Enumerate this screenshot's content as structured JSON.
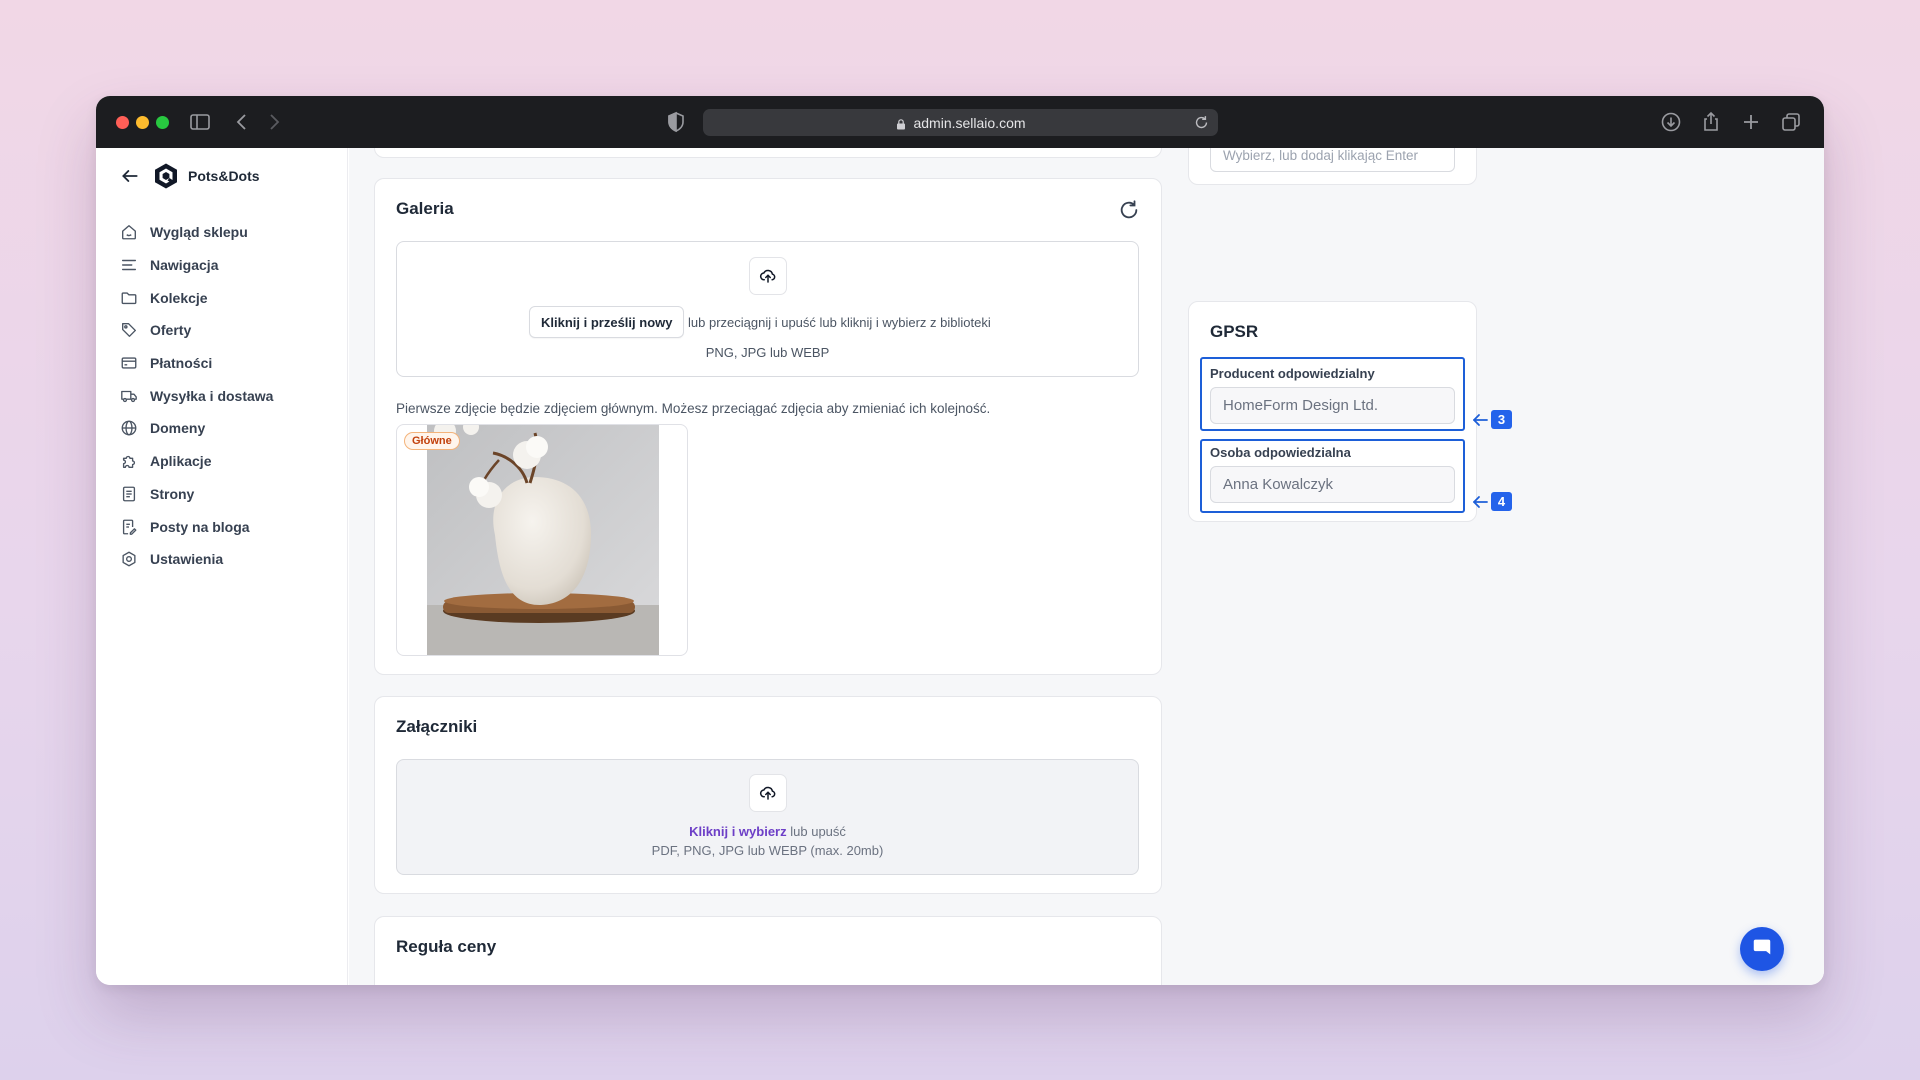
{
  "browser": {
    "url": "admin.sellaio.com"
  },
  "sidebar": {
    "brand": "Pots&Dots",
    "items": [
      {
        "label": "Wygląd sklepu",
        "icon": "home-icon"
      },
      {
        "label": "Nawigacja",
        "icon": "menu-lines-icon"
      },
      {
        "label": "Kolekcje",
        "icon": "folder-icon"
      },
      {
        "label": "Oferty",
        "icon": "tag-icon"
      },
      {
        "label": "Płatności",
        "icon": "credit-card-icon"
      },
      {
        "label": "Wysyłka i dostawa",
        "icon": "truck-icon"
      },
      {
        "label": "Domeny",
        "icon": "globe-icon"
      },
      {
        "label": "Aplikacje",
        "icon": "puzzle-icon"
      },
      {
        "label": "Strony",
        "icon": "document-icon"
      },
      {
        "label": "Posty na bloga",
        "icon": "document-edit-icon"
      },
      {
        "label": "Ustawienia",
        "icon": "gear-icon"
      }
    ]
  },
  "gallery": {
    "title": "Galeria",
    "upload_button": "Kliknij i prześlij nowy",
    "upload_hint": "lub przeciągnij i upuść lub kliknij i wybierz z biblioteki",
    "formats": "PNG, JPG lub WEBP",
    "note": "Pierwsze zdjęcie będzie zdjęciem głównym. Możesz przeciągać zdjęcia aby zmieniać ich kolejność.",
    "main_badge": "Główne"
  },
  "attachments": {
    "title": "Załączniki",
    "link": "Kliknij i wybierz",
    "hint": "lub upuść",
    "formats": "PDF, PNG, JPG lub WEBP (max. 20mb)"
  },
  "price_rule": {
    "title": "Reguła ceny"
  },
  "tags_field": {
    "placeholder": "Wybierz, lub dodaj klikając Enter"
  },
  "gpsr": {
    "title": "GPSR",
    "producer_label": "Producent odpowiedzialny",
    "producer_value": "HomeForm Design Ltd.",
    "person_label": "Osoba odpowiedzialna",
    "person_value": "Anna Kowalczyk"
  },
  "annotations": {
    "marker_3": "3",
    "marker_4": "4",
    "color": "#1d5fd8"
  },
  "colors": {
    "accent_blue": "#1e55e4",
    "link_purple": "#6d3fc7",
    "badge_orange": "#c2410c"
  }
}
